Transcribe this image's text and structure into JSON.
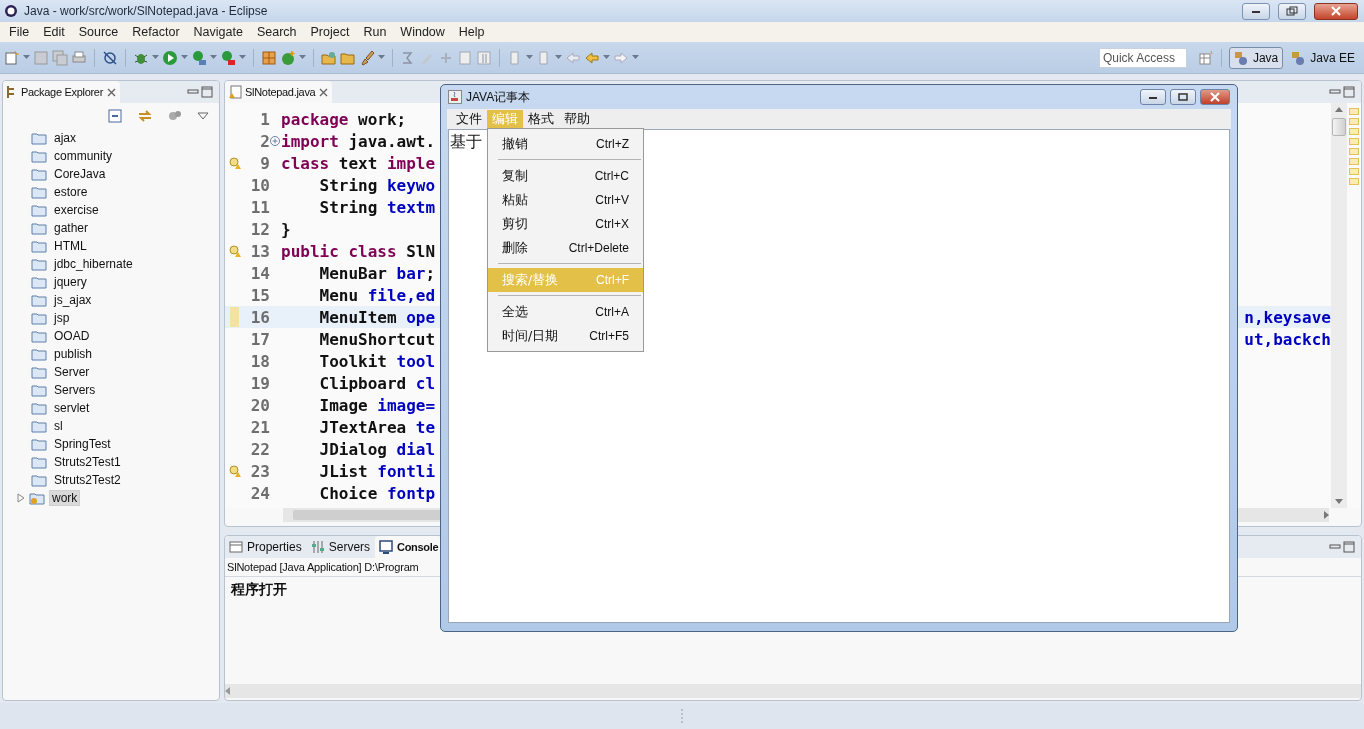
{
  "window": {
    "title": "Java - work/src/work/SlNotepad.java - Eclipse"
  },
  "menu_bar": [
    "File",
    "Edit",
    "Source",
    "Refactor",
    "Navigate",
    "Search",
    "Project",
    "Run",
    "Window",
    "Help"
  ],
  "quick_access": {
    "placeholder": "Quick Access"
  },
  "perspectives": [
    {
      "label": "Java",
      "selected": true
    },
    {
      "label": "Java EE",
      "selected": false
    }
  ],
  "package_explorer": {
    "title": "Package Explorer",
    "items": [
      {
        "label": "ajax",
        "kind": "folder",
        "selected": false
      },
      {
        "label": "community",
        "kind": "folder",
        "selected": false
      },
      {
        "label": "CoreJava",
        "kind": "folder",
        "selected": false
      },
      {
        "label": "estore",
        "kind": "folder",
        "selected": false
      },
      {
        "label": "exercise",
        "kind": "folder",
        "selected": false
      },
      {
        "label": "gather",
        "kind": "folder",
        "selected": false
      },
      {
        "label": "HTML",
        "kind": "folder",
        "selected": false
      },
      {
        "label": "jdbc_hibernate",
        "kind": "folder",
        "selected": false
      },
      {
        "label": "jquery",
        "kind": "folder",
        "selected": false
      },
      {
        "label": "js_ajax",
        "kind": "folder",
        "selected": false
      },
      {
        "label": "jsp",
        "kind": "folder",
        "selected": false
      },
      {
        "label": "OOAD",
        "kind": "folder",
        "selected": false
      },
      {
        "label": "publish",
        "kind": "folder",
        "selected": false
      },
      {
        "label": "Server",
        "kind": "folder",
        "selected": false
      },
      {
        "label": "Servers",
        "kind": "folder",
        "selected": false
      },
      {
        "label": "servlet",
        "kind": "folder",
        "selected": false
      },
      {
        "label": "sl",
        "kind": "folder",
        "selected": false
      },
      {
        "label": "SpringTest",
        "kind": "folder",
        "selected": false
      },
      {
        "label": "Struts2Test1",
        "kind": "folder",
        "selected": false
      },
      {
        "label": "Struts2Test2",
        "kind": "folder",
        "selected": false
      },
      {
        "label": "work",
        "kind": "project",
        "selected": true
      }
    ]
  },
  "editor": {
    "tab": "SlNotepad.java",
    "lines": [
      {
        "number": "1",
        "warning": false,
        "folded": false,
        "current": false,
        "code": [
          {
            "kind": "keyword",
            "text": "package"
          },
          {
            "kind": "plain",
            "text": " work;"
          }
        ]
      },
      {
        "number": "2",
        "warning": false,
        "folded": true,
        "current": false,
        "code": [
          {
            "kind": "keyword",
            "text": "import"
          },
          {
            "kind": "plain",
            "text": " java.awt."
          }
        ]
      },
      {
        "number": "9",
        "warning": true,
        "folded": false,
        "current": false,
        "code": [
          {
            "kind": "keyword",
            "text": "class"
          },
          {
            "kind": "plain",
            "text": " text "
          },
          {
            "kind": "keyword",
            "text": "imple"
          }
        ]
      },
      {
        "number": "10",
        "warning": false,
        "folded": false,
        "current": false,
        "code": [
          {
            "kind": "plain",
            "text": "    String "
          },
          {
            "kind": "field",
            "text": "keywo"
          }
        ]
      },
      {
        "number": "11",
        "warning": false,
        "folded": false,
        "current": false,
        "code": [
          {
            "kind": "plain",
            "text": "    String "
          },
          {
            "kind": "field",
            "text": "textm"
          }
        ]
      },
      {
        "number": "12",
        "warning": false,
        "folded": false,
        "current": false,
        "code": [
          {
            "kind": "plain",
            "text": "}"
          }
        ]
      },
      {
        "number": "13",
        "warning": true,
        "folded": false,
        "current": false,
        "code": [
          {
            "kind": "keyword",
            "text": "public class"
          },
          {
            "kind": "plain",
            "text": " SlN"
          }
        ]
      },
      {
        "number": "14",
        "warning": false,
        "folded": false,
        "current": false,
        "code": [
          {
            "kind": "plain",
            "text": "    MenuBar "
          },
          {
            "kind": "field",
            "text": "bar"
          },
          {
            "kind": "plain",
            "text": ";"
          }
        ]
      },
      {
        "number": "15",
        "warning": false,
        "folded": false,
        "current": false,
        "code": [
          {
            "kind": "plain",
            "text": "    Menu "
          },
          {
            "kind": "field",
            "text": "file,ed"
          }
        ]
      },
      {
        "number": "16",
        "warning": false,
        "folded": false,
        "current": true,
        "code": [
          {
            "kind": "plain",
            "text": "    MenuItem "
          },
          {
            "kind": "field",
            "text": "ope"
          }
        ],
        "right": [
          {
            "kind": "field",
            "text": "n,keysave"
          }
        ]
      },
      {
        "number": "17",
        "warning": false,
        "folded": false,
        "current": false,
        "code": [
          {
            "kind": "plain",
            "text": "    MenuShortcut"
          }
        ],
        "right": [
          {
            "kind": "field",
            "text": "ut,backch"
          }
        ]
      },
      {
        "number": "18",
        "warning": false,
        "folded": false,
        "current": false,
        "code": [
          {
            "kind": "plain",
            "text": "    Toolkit "
          },
          {
            "kind": "field",
            "text": "tool"
          }
        ]
      },
      {
        "number": "19",
        "warning": false,
        "folded": false,
        "current": false,
        "code": [
          {
            "kind": "plain",
            "text": "    Clipboard "
          },
          {
            "kind": "field",
            "text": "cl"
          }
        ]
      },
      {
        "number": "20",
        "warning": false,
        "folded": false,
        "current": false,
        "code": [
          {
            "kind": "plain",
            "text": "    Image "
          },
          {
            "kind": "field",
            "text": "image="
          }
        ]
      },
      {
        "number": "21",
        "warning": false,
        "folded": false,
        "current": false,
        "code": [
          {
            "kind": "plain",
            "text": "    JTextArea "
          },
          {
            "kind": "field",
            "text": "te"
          }
        ]
      },
      {
        "number": "22",
        "warning": false,
        "folded": false,
        "current": false,
        "code": [
          {
            "kind": "plain",
            "text": "    JDialog "
          },
          {
            "kind": "field",
            "text": "dial"
          }
        ]
      },
      {
        "number": "23",
        "warning": true,
        "folded": false,
        "current": false,
        "code": [
          {
            "kind": "plain",
            "text": "    JList "
          },
          {
            "kind": "field",
            "text": "fontli"
          }
        ]
      },
      {
        "number": "24",
        "warning": false,
        "folded": false,
        "current": false,
        "code": [
          {
            "kind": "plain",
            "text": "    Choice "
          },
          {
            "kind": "field",
            "text": "fontp"
          }
        ]
      }
    ]
  },
  "bottom_panel": {
    "tabs": [
      {
        "label": "Properties",
        "kind": "properties",
        "selected": false
      },
      {
        "label": "Servers",
        "kind": "servers",
        "selected": false
      },
      {
        "label": "Console",
        "kind": "console",
        "selected": true
      }
    ],
    "console_header": "SlNotepad [Java Application] D:\\Program",
    "console_output": "程序打开"
  },
  "notepad": {
    "title": "JAVA记事本",
    "menus": [
      {
        "label": "文件",
        "selected": false
      },
      {
        "label": "编辑",
        "selected": true
      },
      {
        "label": "格式",
        "selected": false
      },
      {
        "label": "帮助",
        "selected": false
      }
    ],
    "text": "基于",
    "dropdown": [
      {
        "kind": "item",
        "label": "撤销",
        "shortcut": "Ctrl+Z",
        "selected": false
      },
      {
        "kind": "separator"
      },
      {
        "kind": "item",
        "label": "复制",
        "shortcut": "Ctrl+C",
        "selected": false
      },
      {
        "kind": "item",
        "label": "粘贴",
        "shortcut": "Ctrl+V",
        "selected": false
      },
      {
        "kind": "item",
        "label": "剪切",
        "shortcut": "Ctrl+X",
        "selected": false
      },
      {
        "kind": "item",
        "label": "删除",
        "shortcut": "Ctrl+Delete",
        "selected": false
      },
      {
        "kind": "separator"
      },
      {
        "kind": "item",
        "label": "搜索/替换",
        "shortcut": "Ctrl+F",
        "selected": true
      },
      {
        "kind": "separator"
      },
      {
        "kind": "item",
        "label": "全选",
        "shortcut": "Ctrl+A",
        "selected": false
      },
      {
        "kind": "item",
        "label": "时间/日期",
        "shortcut": "Ctrl+F5",
        "selected": false
      }
    ]
  }
}
